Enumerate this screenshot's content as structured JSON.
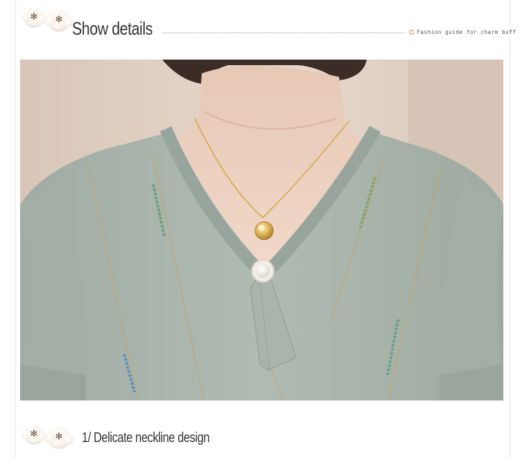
{
  "header": {
    "title": "Show details",
    "tagline": "Fashion guide for charm buff"
  },
  "product_photo": {
    "subject": "neckline-closeup",
    "colors": {
      "knit": "#a9b5ac",
      "background": "#e2d2c5",
      "chain": "#d4a94a"
    }
  },
  "section": {
    "label": "1/ Delicate neckline design"
  },
  "icons": {
    "decoration": "cotton-flower-icon"
  }
}
